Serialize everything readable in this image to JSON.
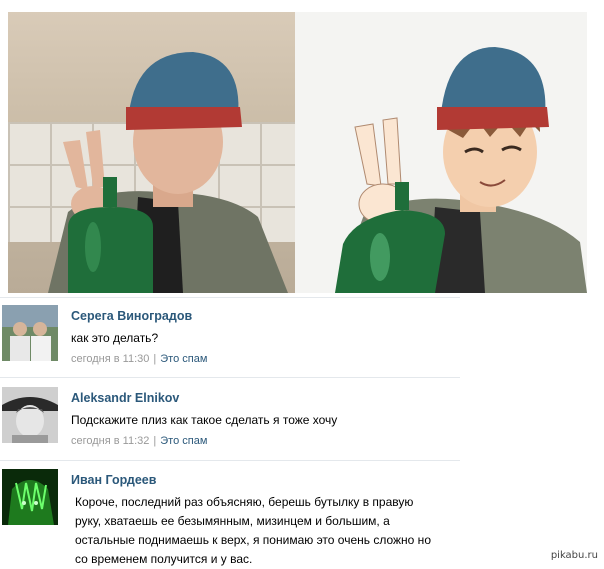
{
  "comments": [
    {
      "author": "Серега Виноградов",
      "text": "как это делать?",
      "time": "сегодня в 11:30",
      "spam_link": "Это спам"
    },
    {
      "author": "Aleksandr Elnikov",
      "text": "Подскажите плиз как такое сделать я тоже хочу",
      "time": "сегодня в 11:32",
      "spam_link": "Это спам"
    },
    {
      "author": "Иван Гордеев",
      "text_lines": [
        "Короче, последний раз объясняю, берешь бутылку в правую",
        "руку, хватаешь ее безымянным, мизинцем и большим, а",
        "остальные поднимаешь к верх, я понимаю это очень сложно но",
        "со временем получится и у вас."
      ]
    }
  ],
  "watermark": "pikabu.ru",
  "colors": {
    "link": "#2b587a",
    "meta": "#999999",
    "beanie": "#3f6e8c",
    "beanie_band": "#b23a34",
    "bottle": "#1f6e3a",
    "jacket": "#6f7464"
  }
}
